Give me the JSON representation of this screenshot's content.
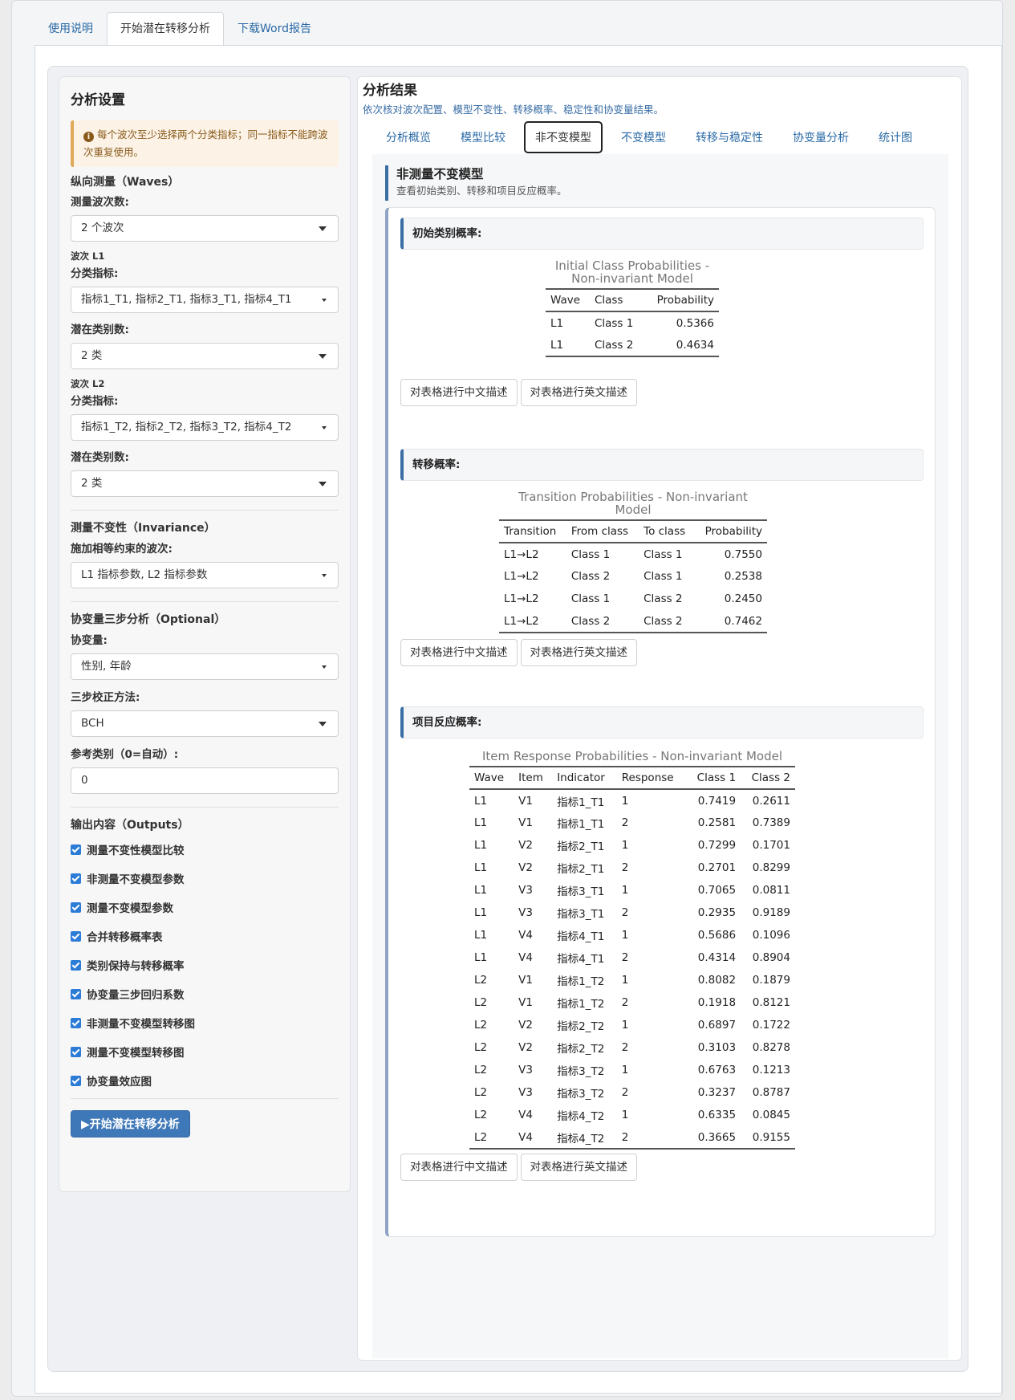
{
  "top_tabs": [
    "使用说明",
    "开始潜在转移分析",
    "下载Word报告"
  ],
  "sidebar": {
    "title": "分析设置",
    "warning": "每个波次至少选择两个分类指标；同一指标不能跨波次重复使用。",
    "waves_section": "纵向测量（Waves）",
    "wave_count_label": "测量波次数:",
    "wave_count_value": "2 个波次",
    "wave1": {
      "title": "波次 L1",
      "indicators_label": "分类指标:",
      "indicators_value": "指标1_T1, 指标2_T1, 指标3_T1, 指标4_T1",
      "classes_label": "潜在类别数:",
      "classes_value": "2 类"
    },
    "wave2": {
      "title": "波次 L2",
      "indicators_label": "分类指标:",
      "indicators_value": "指标1_T2, 指标2_T2, 指标3_T2, 指标4_T2",
      "classes_label": "潜在类别数:",
      "classes_value": "2 类"
    },
    "invariance_section": "测量不变性（Invariance）",
    "invariance_label": "施加相等约束的波次:",
    "invariance_value": "L1 指标参数, L2 指标参数",
    "covariate_section": "协变量三步分析（Optional）",
    "covariate_label": "协变量:",
    "covariate_value": "性别, 年龄",
    "correction_label": "三步校正方法:",
    "correction_value": "BCH",
    "reference_label": "参考类别（0=自动）:",
    "reference_value": "0",
    "outputs_section": "输出内容（Outputs）",
    "outputs": [
      "测量不变性模型比较",
      "非测量不变模型参数",
      "测量不变模型参数",
      "合并转移概率表",
      "类别保持与转移概率",
      "协变量三步回归系数",
      "非测量不变模型转移图",
      "测量不变模型转移图",
      "协变量效应图"
    ],
    "run_button": "开始潜在转移分析"
  },
  "results": {
    "title": "分析结果",
    "subtitle": "依次核对波次配置、模型不变性、转移概率、稳定性和协变量结果。",
    "tabs": [
      "分析概览",
      "模型比较",
      "非不变模型",
      "不变模型",
      "转移与稳定性",
      "协变量分析",
      "统计图"
    ],
    "pane_title": "非测量不变模型",
    "pane_subtitle": "查看初始类别、转移和项目反应概率。",
    "buttons": {
      "cn": "对表格进行中文描述",
      "en": "对表格进行英文描述"
    },
    "initial": {
      "header": "初始类别概率:",
      "caption": "Initial Class Probabilities - Non-invariant Model",
      "columns": [
        "Wave",
        "Class",
        "Probability"
      ],
      "rows": [
        [
          "L1",
          "Class 1",
          "0.5366"
        ],
        [
          "L1",
          "Class 2",
          "0.4634"
        ]
      ]
    },
    "transition": {
      "header": "转移概率:",
      "caption": "Transition Probabilities - Non-invariant Model",
      "columns": [
        "Transition",
        "From class",
        "To class",
        "Probability"
      ],
      "rows": [
        [
          "L1→L2",
          "Class 1",
          "Class 1",
          "0.7550"
        ],
        [
          "L1→L2",
          "Class 2",
          "Class 1",
          "0.2538"
        ],
        [
          "L1→L2",
          "Class 1",
          "Class 2",
          "0.2450"
        ],
        [
          "L1→L2",
          "Class 2",
          "Class 2",
          "0.7462"
        ]
      ]
    },
    "items": {
      "header": "项目反应概率:",
      "caption": "Item Response Probabilities - Non-invariant Model",
      "columns": [
        "Wave",
        "Item",
        "Indicator",
        "Response",
        "Class 1",
        "Class 2"
      ],
      "rows": [
        [
          "L1",
          "V1",
          "指标1_T1",
          "1",
          "0.7419",
          "0.2611"
        ],
        [
          "L1",
          "V1",
          "指标1_T1",
          "2",
          "0.2581",
          "0.7389"
        ],
        [
          "L1",
          "V2",
          "指标2_T1",
          "1",
          "0.7299",
          "0.1701"
        ],
        [
          "L1",
          "V2",
          "指标2_T1",
          "2",
          "0.2701",
          "0.8299"
        ],
        [
          "L1",
          "V3",
          "指标3_T1",
          "1",
          "0.7065",
          "0.0811"
        ],
        [
          "L1",
          "V3",
          "指标3_T1",
          "2",
          "0.2935",
          "0.9189"
        ],
        [
          "L1",
          "V4",
          "指标4_T1",
          "1",
          "0.5686",
          "0.1096"
        ],
        [
          "L1",
          "V4",
          "指标4_T1",
          "2",
          "0.4314",
          "0.8904"
        ],
        [
          "L2",
          "V1",
          "指标1_T2",
          "1",
          "0.8082",
          "0.1879"
        ],
        [
          "L2",
          "V1",
          "指标1_T2",
          "2",
          "0.1918",
          "0.8121"
        ],
        [
          "L2",
          "V2",
          "指标2_T2",
          "1",
          "0.6897",
          "0.1722"
        ],
        [
          "L2",
          "V2",
          "指标2_T2",
          "2",
          "0.3103",
          "0.8278"
        ],
        [
          "L2",
          "V3",
          "指标3_T2",
          "1",
          "0.6763",
          "0.1213"
        ],
        [
          "L2",
          "V3",
          "指标3_T2",
          "2",
          "0.3237",
          "0.8787"
        ],
        [
          "L2",
          "V4",
          "指标4_T2",
          "1",
          "0.6335",
          "0.0845"
        ],
        [
          "L2",
          "V4",
          "指标4_T2",
          "2",
          "0.3665",
          "0.9155"
        ]
      ]
    }
  }
}
